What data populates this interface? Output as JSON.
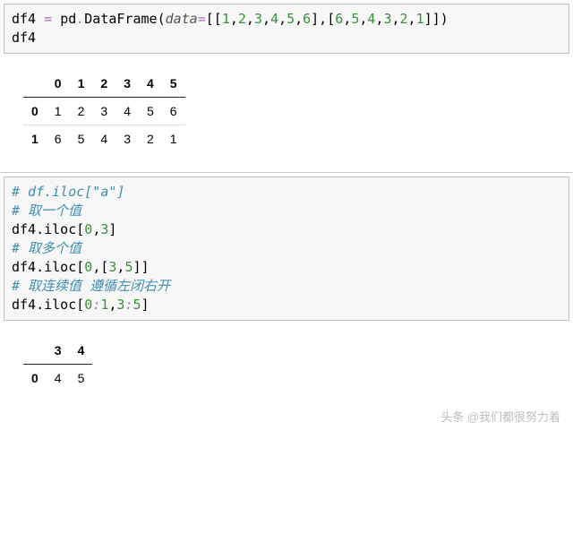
{
  "code1": {
    "l1_var": "df4",
    "l1_eq": " = ",
    "l1_pd": "pd",
    "l1_dot": ".",
    "l1_fn": "DataFrame",
    "l1_open": "(",
    "l1_arg": "data",
    "l1_argop": "=",
    "l1_ob1": "[[",
    "l1_n0": "1",
    "l1_c0": ",",
    "l1_n1": "2",
    "l1_c1": ",",
    "l1_n2": "3",
    "l1_c2": ",",
    "l1_n3": "4",
    "l1_c3": ",",
    "l1_n4": "5",
    "l1_c4": ",",
    "l1_n5": "6",
    "l1_mid": "],[",
    "l1_m0": "6",
    "l1_d0": ",",
    "l1_m1": "5",
    "l1_d1": ",",
    "l1_m2": "4",
    "l1_d2": ",",
    "l1_m3": "3",
    "l1_d3": ",",
    "l1_m4": "2",
    "l1_d4": ",",
    "l1_m5": "1",
    "l1_close": "]])",
    "l2": "df4"
  },
  "table1": {
    "cols": [
      "0",
      "1",
      "2",
      "3",
      "4",
      "5"
    ],
    "rows": [
      {
        "idx": "0",
        "vals": [
          "1",
          "2",
          "3",
          "4",
          "5",
          "6"
        ]
      },
      {
        "idx": "1",
        "vals": [
          "6",
          "5",
          "4",
          "3",
          "2",
          "1"
        ]
      }
    ]
  },
  "code2": {
    "c1": "# df.iloc[\"a\"]",
    "c2": "# 取一个值",
    "l3a": "df4.iloc[",
    "l3n0": "0",
    "l3cm": ",",
    "l3n1": "3",
    "l3z": "]",
    "c4": "# 取多个值",
    "l5a": "df4.iloc[",
    "l5n0": "0",
    "l5cm": ",[",
    "l5n1": "3",
    "l5cm2": ",",
    "l5n2": "5",
    "l5z": "]]",
    "c6": "# 取连续值 遵循左闭右开",
    "l7a": "df4.iloc[",
    "l7n0": "0",
    "l7col": ":",
    "l7n1": "1",
    "l7cm": ",",
    "l7n2": "3",
    "l7col2": ":",
    "l7n3": "5",
    "l7z": "]"
  },
  "table2": {
    "cols": [
      "3",
      "4"
    ],
    "rows": [
      {
        "idx": "0",
        "vals": [
          "4",
          "5"
        ]
      }
    ]
  },
  "watermark": "头条 @我们都很努力着",
  "chart_data": [
    {
      "type": "table",
      "title": "df4",
      "columns": [
        "0",
        "1",
        "2",
        "3",
        "4",
        "5"
      ],
      "index": [
        "0",
        "1"
      ],
      "values": [
        [
          1,
          2,
          3,
          4,
          5,
          6
        ],
        [
          6,
          5,
          4,
          3,
          2,
          1
        ]
      ]
    },
    {
      "type": "table",
      "title": "df4.iloc[0:1,3:5]",
      "columns": [
        "3",
        "4"
      ],
      "index": [
        "0"
      ],
      "values": [
        [
          4,
          5
        ]
      ]
    }
  ]
}
